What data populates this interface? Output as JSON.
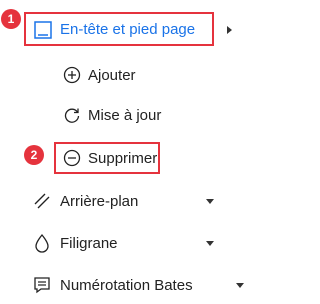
{
  "menu": {
    "header_footer": {
      "label": "En-tête et pied page",
      "badge": "1"
    },
    "sub_items": [
      {
        "label": "Ajouter",
        "icon": "plus-circle-icon"
      },
      {
        "label": "Mise à jour",
        "icon": "refresh-icon"
      },
      {
        "label": "Supprimer",
        "icon": "minus-circle-icon",
        "badge": "2"
      }
    ],
    "items": [
      {
        "label": "Arrière-plan",
        "icon": "background-icon"
      },
      {
        "label": "Filigrane",
        "icon": "watermark-icon"
      },
      {
        "label": "Numérotation Bates",
        "icon": "bates-icon"
      }
    ]
  },
  "colors": {
    "accent": "#1a73e8",
    "highlight": "#e5333d"
  }
}
